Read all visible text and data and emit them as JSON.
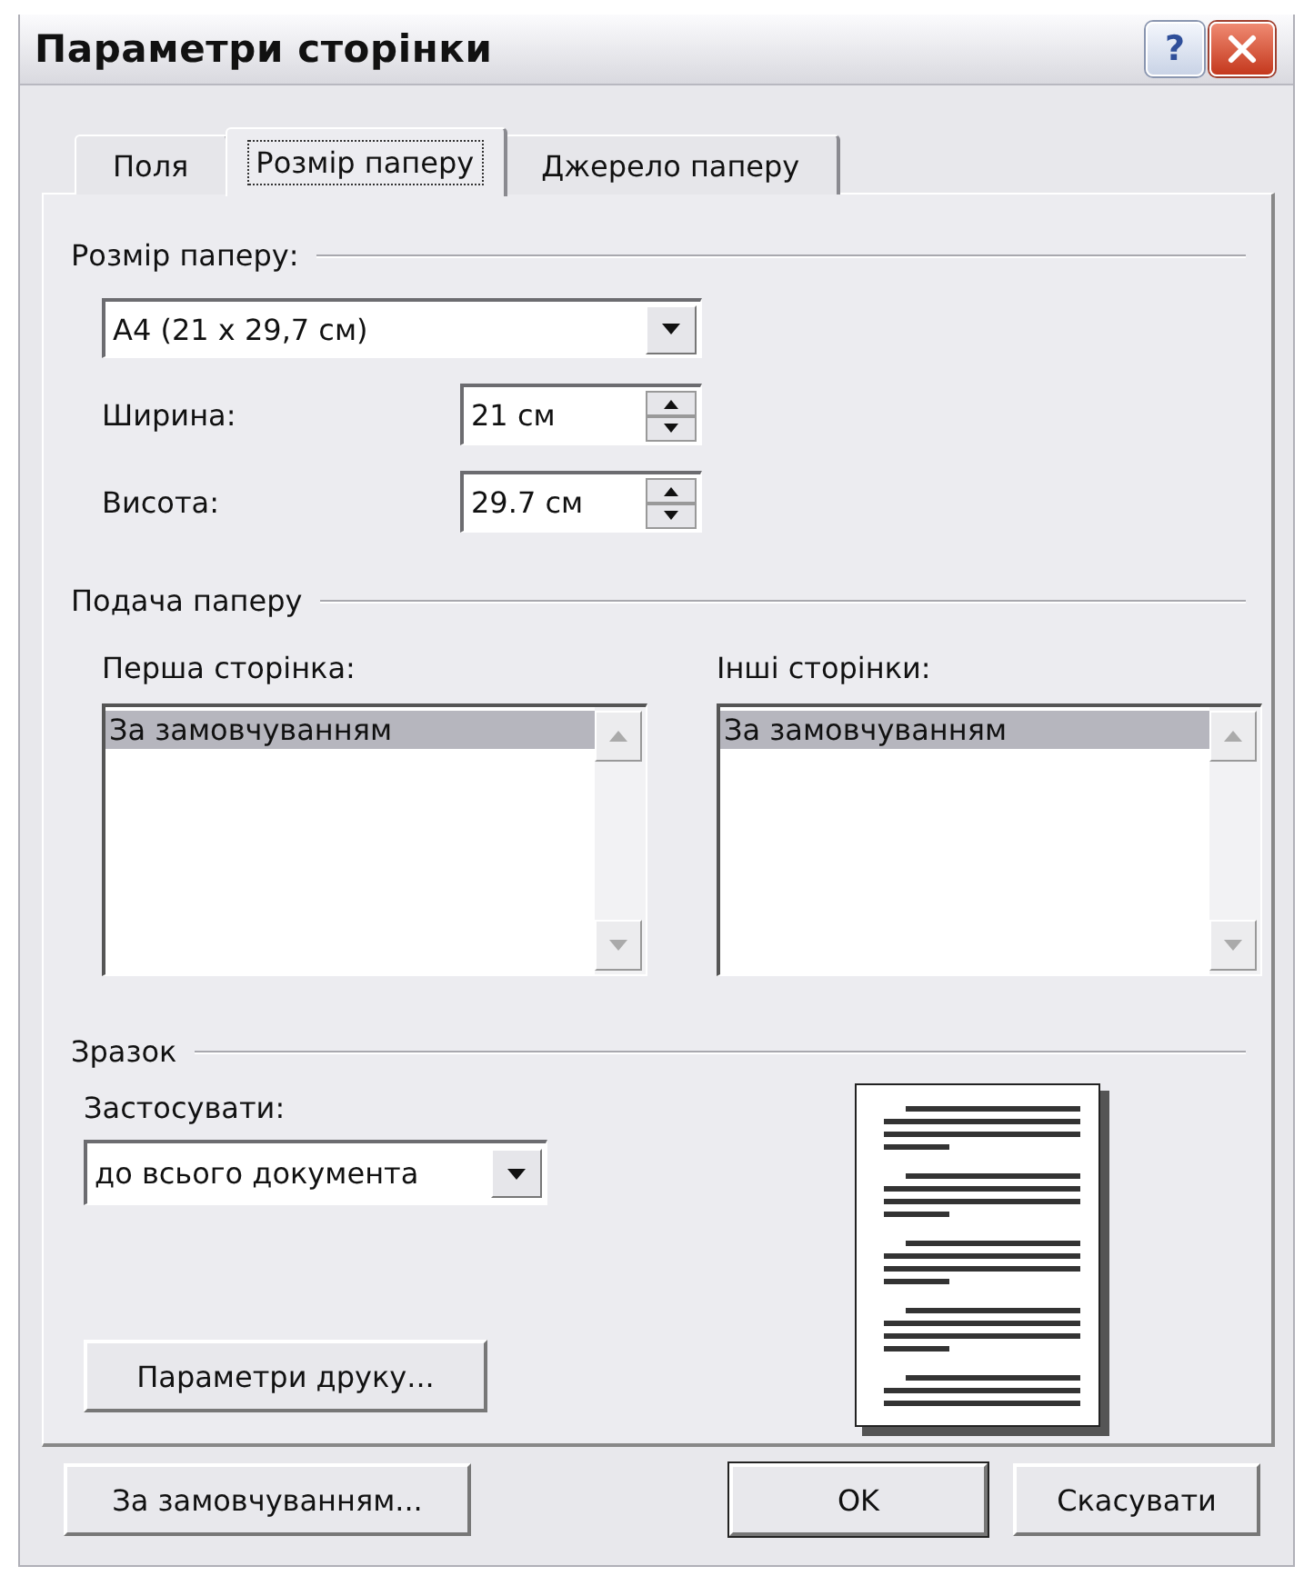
{
  "window": {
    "title": "Параметри сторінки",
    "help_button": "?"
  },
  "tabs": [
    {
      "label": "Поля",
      "selected": false
    },
    {
      "label": "Розмір паперу",
      "selected": true
    },
    {
      "label": "Джерело паперу",
      "selected": false
    }
  ],
  "paper_size": {
    "heading": "Розмір паперу:",
    "size": {
      "value": "A4 (21 x 29,7 см)"
    },
    "fields": [
      {
        "label": "Ширина:",
        "value": "21 см"
      },
      {
        "label": "Висота:",
        "value": "29.7 см"
      }
    ]
  },
  "paper_feed": {
    "heading": "Подача паперу",
    "trays": [
      {
        "label": "Перша сторінка:",
        "items": [
          {
            "text": "За замовчуванням",
            "selected": true
          }
        ]
      },
      {
        "label": "Інші сторінки:",
        "items": [
          {
            "text": "За замовчуванням",
            "selected": true
          }
        ]
      }
    ]
  },
  "preview": {
    "heading": "Зразок",
    "apply_label": "Застосувати:",
    "apply_to": {
      "value": "до всього документа"
    },
    "print_options_button": "Параметри друку..."
  },
  "footer_buttons": [
    {
      "label": "За замовчуванням...",
      "default": false
    },
    {
      "label": "OK",
      "default": true
    },
    {
      "label": "Скасувати",
      "default": false
    }
  ]
}
